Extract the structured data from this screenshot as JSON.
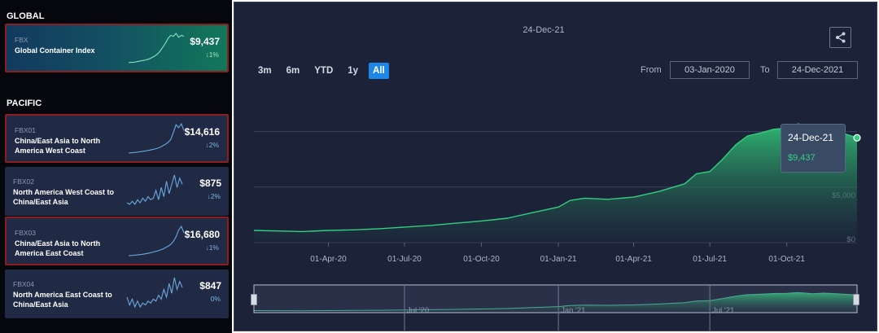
{
  "sidebar": {
    "global_heading": "GLOBAL",
    "pacific_heading": "PACIFIC",
    "cards": [
      {
        "code": "FBX",
        "name": "Global Container Index",
        "price": "$9,437",
        "change": "1%",
        "direction": "down",
        "selected": true,
        "spark_color": "#7fe3c0",
        "spark": [
          10,
          10.5,
          10.3,
          11,
          11.5,
          12,
          12.4,
          13.2,
          14,
          15.5,
          17,
          19,
          22,
          26,
          30,
          35,
          38,
          37,
          40,
          36,
          38,
          37
        ]
      },
      {
        "code": "FBX01",
        "name": "China/East Asia to North America West Coast",
        "price": "$14,616",
        "change": "2%",
        "direction": "down",
        "selected": true,
        "spark_color": "#6aa8e0",
        "spark": [
          10,
          10.3,
          10.5,
          10.8,
          11.2,
          11.6,
          12,
          12.5,
          13,
          13.6,
          14.2,
          15,
          16,
          17.5,
          19,
          21,
          24,
          31,
          39,
          36,
          40,
          33
        ]
      },
      {
        "code": "FBX02",
        "name": "North America West Coast to China/East Asia",
        "price": "$875",
        "change": "2%",
        "direction": "down",
        "selected": false,
        "spark_color": "#6aa8e0",
        "spark": [
          12,
          11,
          13,
          11,
          14,
          12,
          15,
          13,
          16,
          14,
          15,
          20,
          14,
          22,
          16,
          26,
          18,
          24,
          30,
          22,
          28,
          24
        ]
      },
      {
        "code": "FBX03",
        "name": "China/East Asia to North America East Coast",
        "price": "$16,680",
        "change": "1%",
        "direction": "down",
        "selected": true,
        "spark_color": "#6aa8e0",
        "spark": [
          10,
          10.2,
          10.4,
          10.7,
          11,
          11.4,
          11.8,
          12.3,
          12.8,
          13.5,
          14.3,
          15,
          16,
          17,
          18.5,
          20,
          22,
          25,
          30,
          37,
          41,
          34
        ]
      },
      {
        "code": "FBX04",
        "name": "North America East Coast to China/East Asia",
        "price": "$847",
        "change": "0%",
        "direction": "flat",
        "selected": false,
        "spark_color": "#6aa8e0",
        "spark": [
          16,
          12,
          15,
          11,
          14,
          11,
          13,
          12,
          14,
          13,
          15,
          14,
          17,
          15,
          20,
          16,
          23,
          18,
          26,
          20,
          24,
          21
        ]
      }
    ]
  },
  "chart": {
    "header_date": "24-Dec-21",
    "range_buttons": [
      "3m",
      "6m",
      "YTD",
      "1y",
      "All"
    ],
    "active_range": "All",
    "from_label": "From",
    "from_value": "03-Jan-2020",
    "to_label": "To",
    "to_value": "24-Dec-2021",
    "tooltip_date": "24-Dec-21",
    "tooltip_value": "$9,437",
    "share_icon": "share-icon",
    "colors": {
      "panel": "#1c2238",
      "line": "#31d07f",
      "area_top": "#2fb871",
      "area_bottom": "#1c2a3c",
      "accent": "#1e87e6"
    }
  },
  "chart_data": {
    "type": "area",
    "title": "",
    "xlabel": "",
    "ylabel": "",
    "x_tick_labels": [
      "01-Apr-20",
      "01-Jul-20",
      "01-Oct-20",
      "01-Jan-21",
      "01-Apr-21",
      "01-Jul-21",
      "01-Oct-21"
    ],
    "y_tick_labels": [
      "$0",
      "$5,000",
      "$10,000"
    ],
    "ylim": [
      0,
      14000
    ],
    "grid": true,
    "navigator_labels": [
      "Jul '20",
      "Jan '21",
      "Jul '21"
    ],
    "series": [
      {
        "x": [
          "2020-01-03",
          "2020-02-01",
          "2020-03-01",
          "2020-04-01",
          "2020-05-01",
          "2020-06-01",
          "2020-07-01",
          "2020-08-01",
          "2020-09-01",
          "2020-10-01",
          "2020-11-01",
          "2020-12-01",
          "2021-01-01",
          "2021-01-15",
          "2021-02-01",
          "2021-03-01",
          "2021-04-01",
          "2021-05-01",
          "2021-06-01",
          "2021-06-15",
          "2021-07-01",
          "2021-07-15",
          "2021-08-01",
          "2021-08-15",
          "2021-09-01",
          "2021-09-15",
          "2021-10-01",
          "2021-10-15",
          "2021-11-01",
          "2021-11-15",
          "2021-12-01",
          "2021-12-24"
        ],
        "y": [
          1100,
          1050,
          1000,
          1100,
          1150,
          1250,
          1400,
          1550,
          1750,
          1950,
          2200,
          2700,
          3200,
          3800,
          4000,
          3900,
          4100,
          4600,
          5300,
          6200,
          6400,
          7400,
          8800,
          9600,
          9900,
          10200,
          10300,
          10700,
          10100,
          10400,
          10000,
          9437
        ]
      }
    ]
  }
}
